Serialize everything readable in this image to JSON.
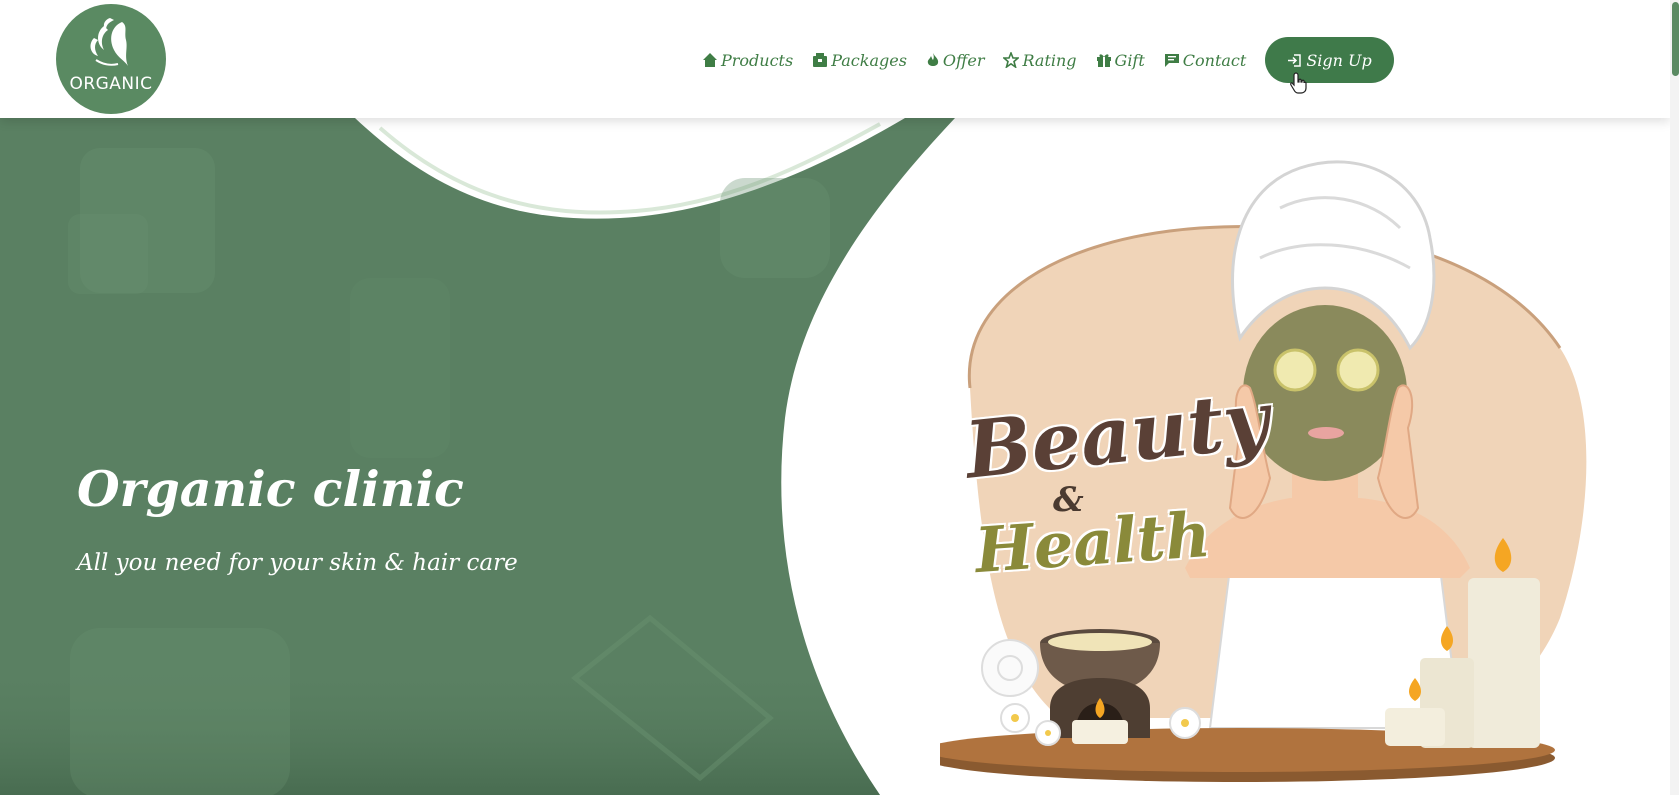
{
  "brand": {
    "logo_text": "ORGANIC"
  },
  "nav": {
    "items": [
      {
        "label": "Products",
        "icon": "home-icon"
      },
      {
        "label": "Packages",
        "icon": "box-icon"
      },
      {
        "label": "Offer",
        "icon": "flame-icon"
      },
      {
        "label": "Rating",
        "icon": "star-icon"
      },
      {
        "label": "Gift",
        "icon": "gift-icon"
      },
      {
        "label": "Contact",
        "icon": "message-icon"
      }
    ],
    "signup_label": "Sign Up",
    "signup_icon": "sign-in-icon"
  },
  "hero": {
    "title": "Organic clinic",
    "subtitle": "All you need for your skin & hair care",
    "illustration": {
      "line1": "Beauty",
      "ampersand": "&",
      "line2": "Health"
    }
  },
  "colors": {
    "primary_green": "#5a8062",
    "nav_text": "#3f7d45",
    "button_green": "#3f7a4a",
    "beige": "#f0d4b8"
  }
}
